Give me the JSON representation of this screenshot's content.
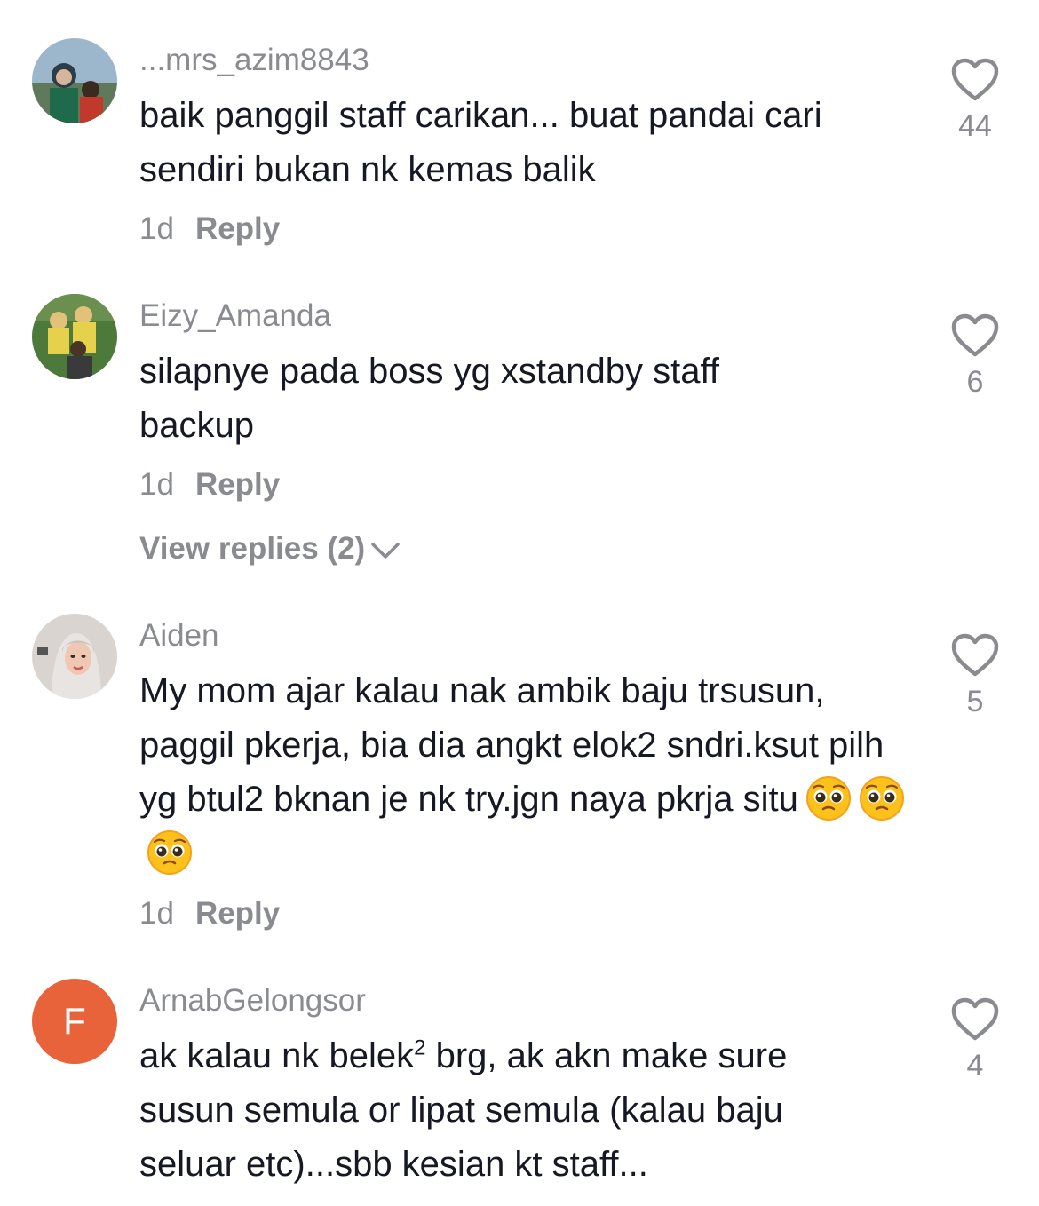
{
  "comments": [
    {
      "username": "...mrs_azim8843",
      "text": "baik panggil staff carikan... buat pandai cari sendiri bukan nk kemas balik",
      "time": "1d",
      "reply_label": "Reply",
      "likes": "44",
      "avatar_icon": "photo-avatar"
    },
    {
      "username": "Eizy_Amanda",
      "text": "silapnye pada boss yg xstandby staff backup",
      "time": "1d",
      "reply_label": "Reply",
      "likes": "6",
      "view_replies": "View replies (2)",
      "avatar_icon": "photo-avatar"
    },
    {
      "username": "Aiden",
      "text": "My mom ajar kalau nak ambik baju trsusun, paggil pkerja, bia dia angkt elok2 sndri.ksut pilh yg btul2 bknan je nk try.jgn naya pkrja situ",
      "emoji_count": 3,
      "emoji_icon": "pleading-face-emoji",
      "time": "1d",
      "reply_label": "Reply",
      "likes": "5",
      "avatar_icon": "photo-avatar"
    },
    {
      "username": "ArnabGelongsor",
      "text_part1": "ak kalau nk belek",
      "text_sup": "2",
      "text_part2": " brg, ak akn make sure susun semula or lipat semula (kalau baju seluar etc)...sbb kesian kt staff...",
      "likes": "4",
      "avatar_letter": "F",
      "avatar_color": "#e8623a"
    }
  ],
  "icons": {
    "like": "heart-outline-icon",
    "expand": "chevron-down-icon"
  }
}
